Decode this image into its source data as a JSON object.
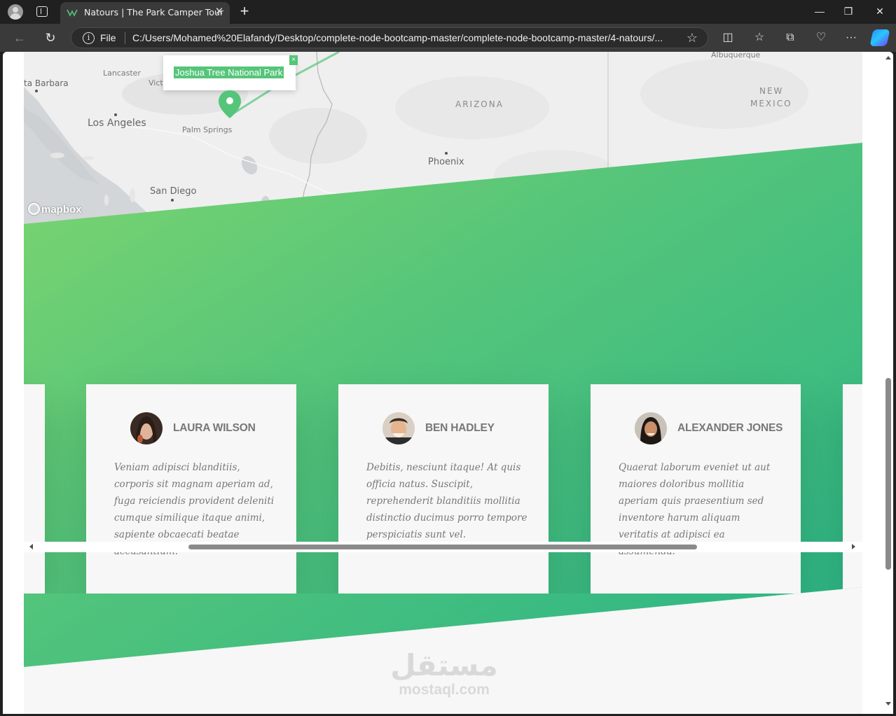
{
  "browser": {
    "tab_title": "Natours | The Park Camper Tour",
    "address_prefix": "File",
    "url": "C:/Users/Mohamed%20Elafandy/Desktop/complete-node-bootcamp-master/complete-node-bootcamp-master/4-natours/..."
  },
  "map": {
    "popup_text": "Joshua Tree National Park",
    "popup_close": "×",
    "attribution": "mapbox",
    "labels": {
      "santa_barbara": "ta Barbara",
      "lancaster": "Lancaster",
      "victorville": "Vict",
      "los_angeles": "Los Angeles",
      "palm_springs": "Palm Springs",
      "san_diego": "San Diego",
      "arizona": "ARIZONA",
      "phoenix": "Phoenix",
      "new_mexico_1": "NEW",
      "new_mexico_2": "MEXICO",
      "albuquerque": "Albuquerque"
    }
  },
  "reviews": [
    {
      "name": "Laura Wilson",
      "text": "Veniam adipisci blanditiis, corporis sit magnam aperiam ad, fuga reiciendis provident deleniti cumque similique itaque animi, sapiente obcaecati beatae accusantium."
    },
    {
      "name": "Ben Hadley",
      "text": "Debitis, nesciunt itaque! At quis officia natus. Suscipit, reprehenderit blanditiis mollitia distinctio ducimus porro tempore perspiciatis sunt vel."
    },
    {
      "name": "Alexander Jones",
      "text": "Quaerat laborum eveniet ut aut maiores doloribus mollitia aperiam quis praesentium sed inventore harum aliquam veritatis at adipisci ea assumenda!"
    }
  ],
  "watermark": {
    "arabic": "مستقل",
    "latin": "mostaql.com"
  },
  "colors": {
    "brand_green": "#55c57a",
    "gradient_light": "#7dd56f",
    "gradient_dark": "#28b487",
    "card_bg": "#f7f7f7",
    "text_gray": "#777777"
  }
}
